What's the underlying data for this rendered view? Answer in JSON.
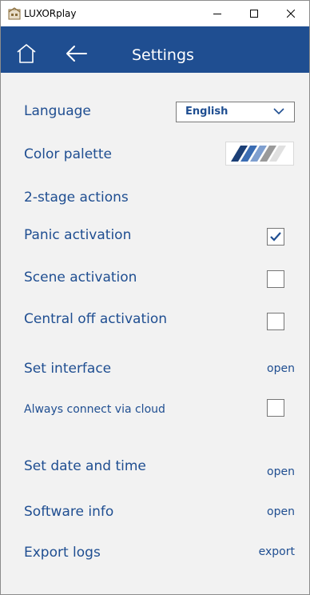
{
  "window": {
    "title": "LUXORplay"
  },
  "header": {
    "title": "Settings"
  },
  "settings": {
    "language": {
      "label": "Language",
      "value": "English"
    },
    "color_palette": {
      "label": "Color palette"
    },
    "two_stage": {
      "label": "2-stage actions"
    },
    "panic": {
      "label": "Panic activation",
      "checked": true
    },
    "scene": {
      "label": "Scene activation",
      "checked": false
    },
    "central_off": {
      "label": "Central off activation",
      "checked": false
    },
    "set_interface": {
      "label": "Set interface",
      "action": "open"
    },
    "cloud": {
      "label": "Always connect via cloud",
      "checked": false
    },
    "date_time": {
      "label": "Set date and time",
      "action": "open"
    },
    "software_info": {
      "label": "Software info",
      "action": "open"
    },
    "export_logs": {
      "label": "Export logs",
      "action": "export"
    }
  },
  "colors": {
    "accent": "#1f4e91",
    "background": "#f2f2f2"
  },
  "icons": [
    "app-icon",
    "minimize-icon",
    "maximize-icon",
    "close-icon",
    "home-icon",
    "back-arrow-icon",
    "chevron-down-icon",
    "checkmark-icon",
    "color-palette-icon"
  ]
}
